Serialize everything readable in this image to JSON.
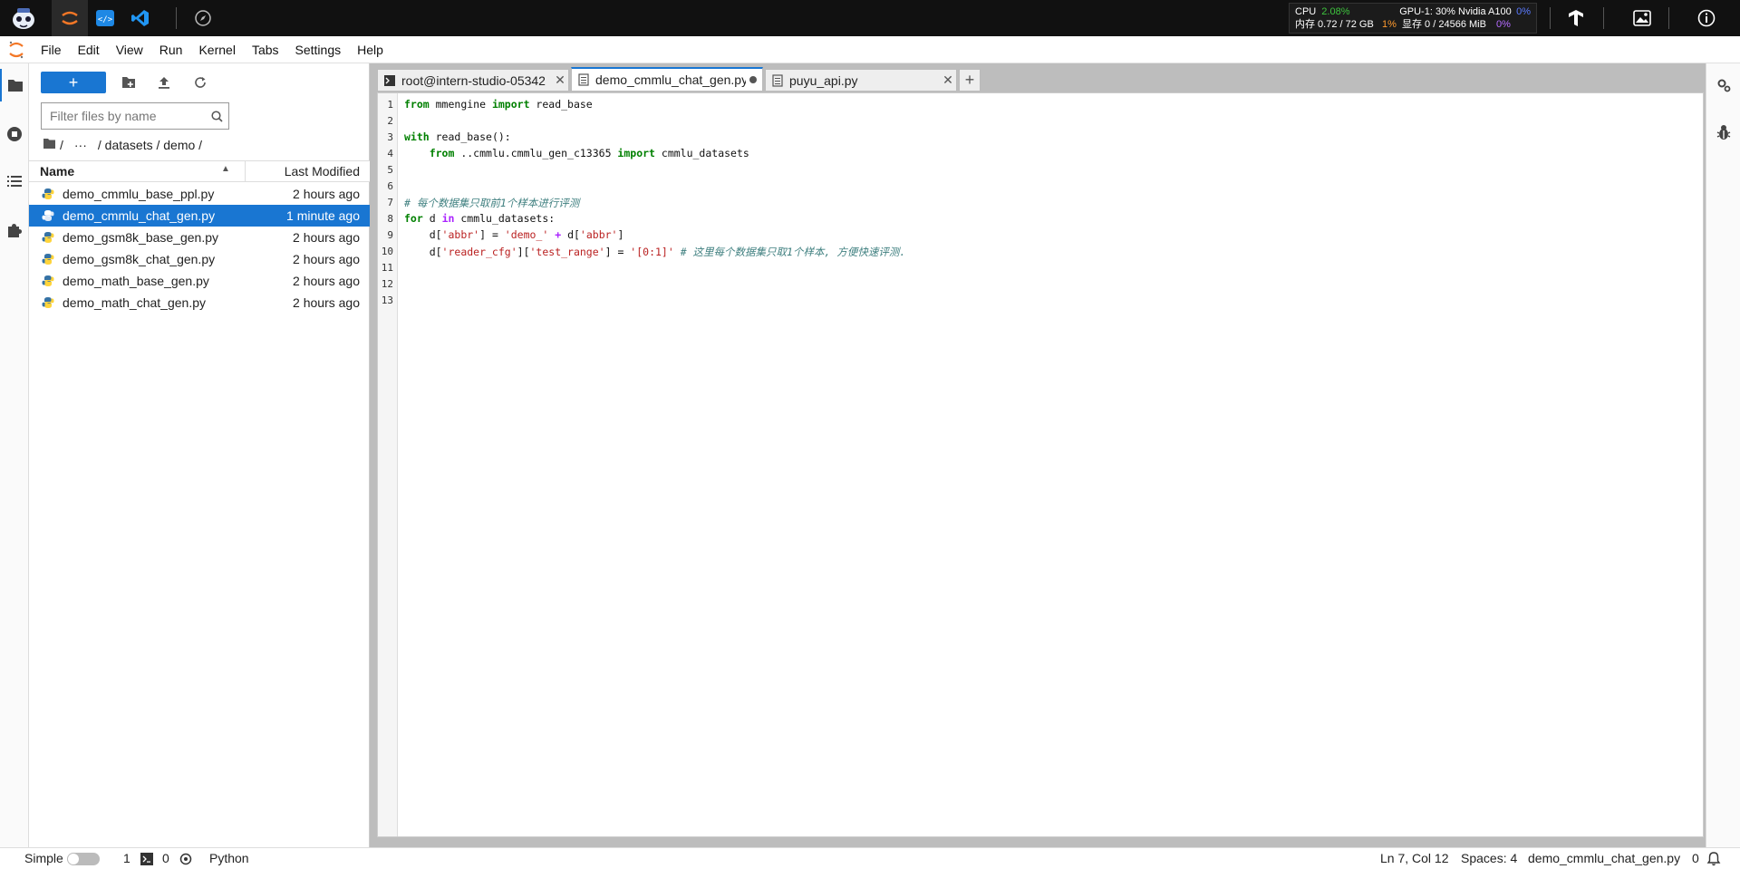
{
  "topbar": {
    "sysmon": {
      "cpu_label": "CPU",
      "cpu_value": "2.08%",
      "mem_label": "内存 0.72 / 72 GB",
      "mem_value": "1%",
      "gpu_label": "GPU-1: 30% Nvidia A100",
      "gpu_value": "0%",
      "vram_label": "显存 0 / 24566 MiB",
      "vram_value": "0%"
    }
  },
  "menubar": {
    "items": [
      "File",
      "Edit",
      "View",
      "Run",
      "Kernel",
      "Tabs",
      "Settings",
      "Help"
    ]
  },
  "filebrowser": {
    "new_label": "+",
    "filter_placeholder": "Filter files by name",
    "breadcrumb": {
      "sep1": "/",
      "ellipsis": "···",
      "path": "/ datasets / demo /"
    },
    "col_name": "Name",
    "col_modified": "Last Modified",
    "files": [
      {
        "name": "demo_cmmlu_base_ppl.py",
        "modified": "2 hours ago"
      },
      {
        "name": "demo_cmmlu_chat_gen.py",
        "modified": "1 minute ago"
      },
      {
        "name": "demo_gsm8k_base_gen.py",
        "modified": "2 hours ago"
      },
      {
        "name": "demo_gsm8k_chat_gen.py",
        "modified": "2 hours ago"
      },
      {
        "name": "demo_math_base_gen.py",
        "modified": "2 hours ago"
      },
      {
        "name": "demo_math_chat_gen.py",
        "modified": "2 hours ago"
      }
    ]
  },
  "tabs": [
    {
      "label": "root@intern-studio-05342"
    },
    {
      "label": "demo_cmmlu_chat_gen.py"
    },
    {
      "label": "puyu_api.py"
    }
  ],
  "editor": {
    "line_numbers": [
      "1",
      "2",
      "3",
      "4",
      "5",
      "6",
      "7",
      "8",
      "9",
      "10",
      "11",
      "12",
      "13"
    ],
    "code": {
      "l1_kw1": "from",
      "l1_t1": " mmengine ",
      "l1_kw2": "import",
      "l1_t2": " read_base",
      "l3_kw1": "with",
      "l3_t1": " read_base():",
      "l4_indent": "    ",
      "l4_kw1": "from",
      "l4_t1": " ..cmmlu.cmmlu_gen_c13365 ",
      "l4_kw2": "import",
      "l4_t2": " cmmlu_datasets",
      "l7_cm": "# 每个数据集只取前1个样本进行评测",
      "l8_kw1": "for",
      "l8_t1": " d ",
      "l8_op1": "in",
      "l8_t2": " cmmlu_datasets:",
      "l9_t1": "    d[",
      "l9_s1": "'abbr'",
      "l9_t2": "] = ",
      "l9_s2": "'demo_'",
      "l9_t3": " ",
      "l9_op1": "+",
      "l9_t4": " d[",
      "l9_s3": "'abbr'",
      "l9_t5": "]",
      "l10_t1": "    d[",
      "l10_s1": "'reader_cfg'",
      "l10_t2": "][",
      "l10_s2": "'test_range'",
      "l10_t3": "] = ",
      "l10_s3": "'[0:1]'",
      "l10_t4": " ",
      "l10_cm": "# 这里每个数据集只取1个样本, 方便快速评测."
    }
  },
  "statusbar": {
    "mode": "Simple",
    "terminals": "1",
    "kernels": "0",
    "kernel_name": "Python",
    "position": "Ln 7, Col 12",
    "spaces": "Spaces: 4",
    "filename": "demo_cmmlu_chat_gen.py",
    "notifications": "0"
  },
  "colors": {
    "accent": "#1976d2",
    "topbar_bg": "#111111",
    "keyword": "#008000",
    "string": "#ba2121",
    "comment": "#408080"
  }
}
